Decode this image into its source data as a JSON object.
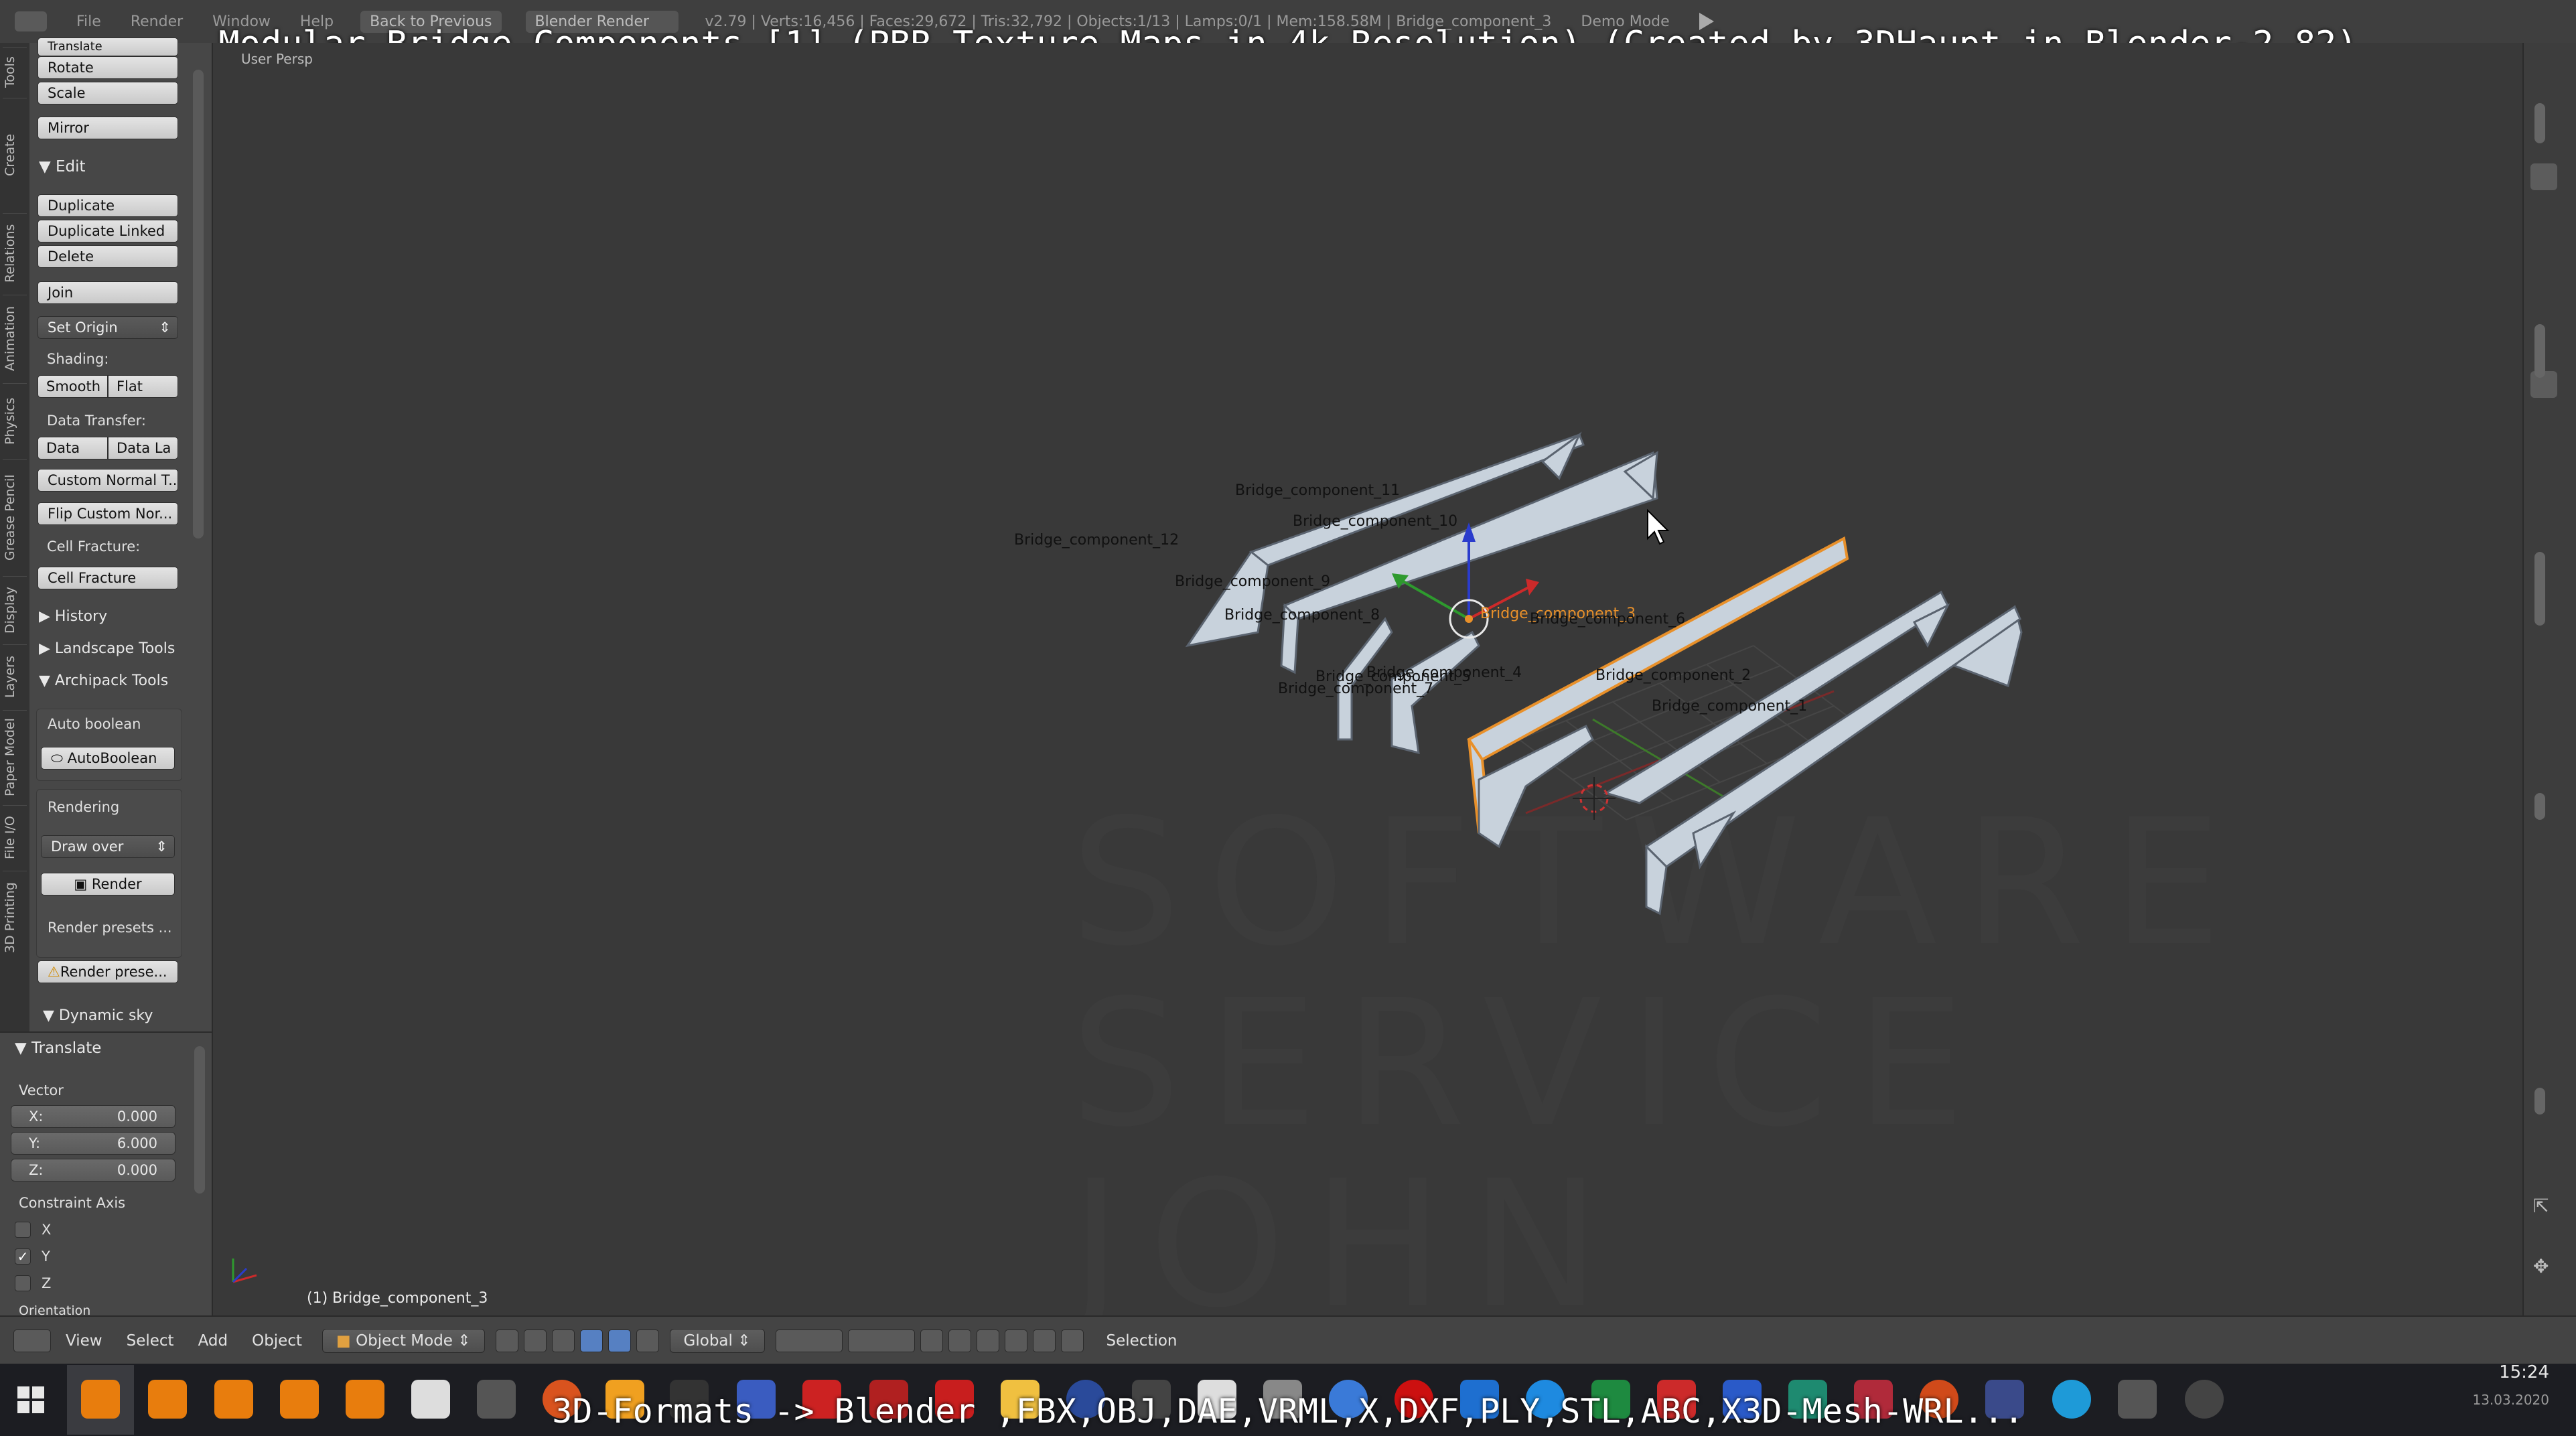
{
  "window": {
    "menu": [
      "File",
      "Render",
      "Window",
      "Help"
    ],
    "back_button": "Back to Previous",
    "render_engine": "Blender Render",
    "stats": "v2.79 | Verts:16,456 | Faces:29,672 | Tris:32,792 | Objects:1/13 | Lamps:0/1 | Mem:158.58M | Bridge_component_3",
    "demo_mode": "Demo Mode"
  },
  "overlay": {
    "title": "Modular Bridge Components [1] (PBR Texture Maps in 4k Resolution) (Created by 3DHaupt in Blender-2.82)",
    "subtitle": "3D-Formats -> Blender ,FBX,OBJ,DAE,VRML,X,DXF,PLY,STL,ABC,X3D-Mesh-WRL..."
  },
  "vertical_tabs": [
    "Tools",
    "Create",
    "Relations",
    "Animation",
    "Physics",
    "Grease Pencil",
    "Display",
    "Layers",
    "Paper Model",
    "File I/O",
    "3D Printing"
  ],
  "tool_shelf": {
    "translate_cut": "Translate",
    "rotate": "Rotate",
    "scale": "Scale",
    "mirror": "Mirror",
    "edit_header": "Edit",
    "duplicate": "Duplicate",
    "duplicate_linked": "Duplicate Linked",
    "delete": "Delete",
    "join": "Join",
    "set_origin": "Set Origin",
    "shading_label": "Shading:",
    "smooth": "Smooth",
    "flat": "Flat",
    "data_transfer_label": "Data Transfer:",
    "data": "Data",
    "data_la": "Data La",
    "custom_normal": "Custom Normal T...",
    "flip_custom": "Flip Custom Nor...",
    "cell_fracture_label": "Cell Fracture:",
    "cell_fracture": "Cell Fracture",
    "history": "History",
    "landscape_tools": "Landscape Tools",
    "archipack_tools": "Archipack Tools",
    "auto_boolean_label": "Auto boolean",
    "autoboolean": "AutoBoolean",
    "rendering_label": "Rendering",
    "draw_over": "Draw over",
    "render": "Render",
    "render_presets_label": "Render presets ...",
    "render_presets_btn": "Render prese...",
    "dynamic_sky": "Dynamic sky"
  },
  "operator_panel": {
    "header": "Translate",
    "vector_label": "Vector",
    "x_key": "X:",
    "x_val": "0.000",
    "y_key": "Y:",
    "y_val": "6.000",
    "z_key": "Z:",
    "z_val": "0.000",
    "constraint_label": "Constraint Axis",
    "cx": "X",
    "cy": "Y",
    "cz": "Z",
    "cx_checked": false,
    "cy_checked": true,
    "cz_checked": false,
    "orientation_label": "Orientation"
  },
  "viewport": {
    "view_name": "User Persp",
    "active_object": "(1) Bridge_component_3",
    "watermark": [
      "SOFTWARE",
      "SERVICE",
      "JOHN"
    ],
    "labels": {
      "c11": "Bridge_component_11",
      "c10": "Bridge_component_10",
      "c12": "Bridge_component_12",
      "c9": "Bridge_component_9",
      "c8": "Bridge_component_8",
      "c3": "Bridge_component_3",
      "c6": "Bridge_component_6",
      "c5": "Bridge_component_5",
      "c7": "Bridge_component_7",
      "c4": "Bridge_component_4",
      "c2": "Bridge_component_2",
      "c1": "Bridge_component_1"
    },
    "selected_color": "#e8902a",
    "mesh_color": "#c8d2dc"
  },
  "header_bar": {
    "view": "View",
    "select": "Select",
    "add": "Add",
    "object": "Object",
    "mode": "Object Mode",
    "orientation": "Global",
    "selection": "Selection"
  },
  "taskbar": {
    "time": "15:24",
    "date": "13.03.2020"
  }
}
